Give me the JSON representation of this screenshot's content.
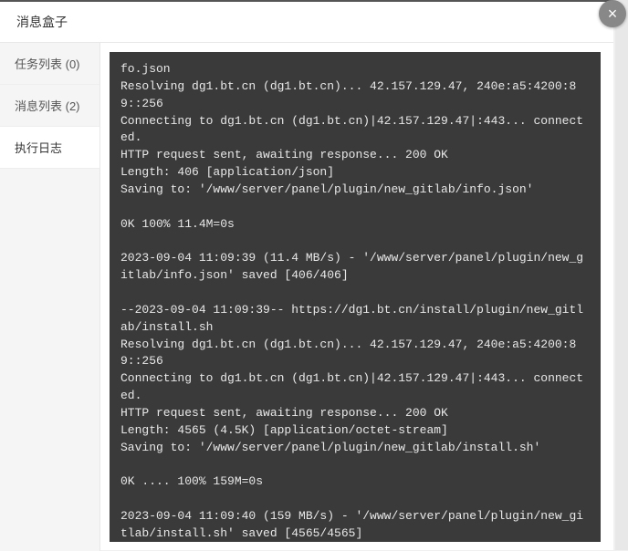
{
  "header": {
    "title": "消息盒子"
  },
  "close_label": "×",
  "sidebar": {
    "tabs": [
      {
        "label": "任务列表 (0)",
        "active": false
      },
      {
        "label": "消息列表 (2)",
        "active": false
      },
      {
        "label": "执行日志",
        "active": true
      }
    ]
  },
  "terminal": {
    "log": "fo.json\nResolving dg1.bt.cn (dg1.bt.cn)... 42.157.129.47, 240e:a5:4200:89::256\nConnecting to dg1.bt.cn (dg1.bt.cn)|42.157.129.47|:443... connected.\nHTTP request sent, awaiting response... 200 OK\nLength: 406 [application/json]\nSaving to: '/www/server/panel/plugin/new_gitlab/info.json'\n\n0K 100% 11.4M=0s\n\n2023-09-04 11:09:39 (11.4 MB/s) - '/www/server/panel/plugin/new_gitlab/info.json' saved [406/406]\n\n--2023-09-04 11:09:39-- https://dg1.bt.cn/install/plugin/new_gitlab/install.sh\nResolving dg1.bt.cn (dg1.bt.cn)... 42.157.129.47, 240e:a5:4200:89::256\nConnecting to dg1.bt.cn (dg1.bt.cn)|42.157.129.47|:443... connected.\nHTTP request sent, awaiting response... 200 OK\nLength: 4565 (4.5K) [application/octet-stream]\nSaving to: '/www/server/panel/plugin/new_gitlab/install.sh'\n\n0K .... 100% 159M=0s\n\n2023-09-04 11:09:40 (159 MB/s) - '/www/server/panel/plugin/new_gitlab/install.sh' saved [4565/4565]\n\ncp: cannot create regular file '/www/server/panel/static/img/soft_ico/ico-gitlab.png': No such file or directory\n|-Successify --- 命令已执行! ---"
  }
}
